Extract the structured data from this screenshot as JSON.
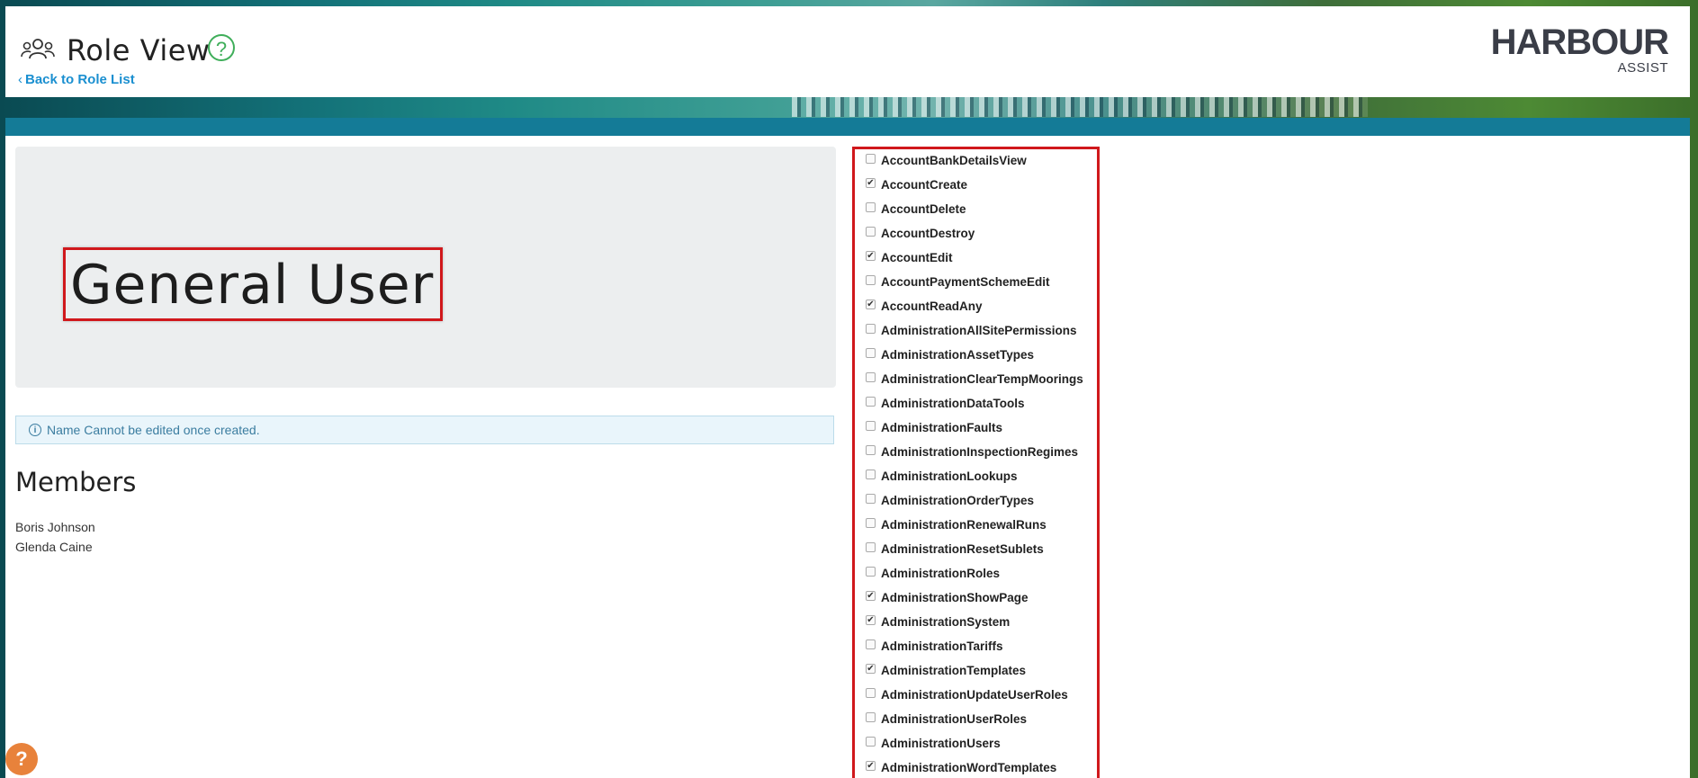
{
  "header": {
    "title": "Role View",
    "back_link": "Back to Role List",
    "logo_main": "HARBOUR",
    "logo_sub": "ASSIST"
  },
  "role": {
    "name": "General User",
    "info_note": "Name Cannot be edited once created."
  },
  "members": {
    "title": "Members",
    "list": [
      "Boris Johnson",
      "Glenda Caine"
    ]
  },
  "permissions": [
    {
      "label": "AccountBankDetailsView",
      "checked": false
    },
    {
      "label": "AccountCreate",
      "checked": true
    },
    {
      "label": "AccountDelete",
      "checked": false
    },
    {
      "label": "AccountDestroy",
      "checked": false
    },
    {
      "label": "AccountEdit",
      "checked": true
    },
    {
      "label": "AccountPaymentSchemeEdit",
      "checked": false
    },
    {
      "label": "AccountReadAny",
      "checked": true
    },
    {
      "label": "AdministrationAllSitePermissions",
      "checked": false
    },
    {
      "label": "AdministrationAssetTypes",
      "checked": false
    },
    {
      "label": "AdministrationClearTempMoorings",
      "checked": false
    },
    {
      "label": "AdministrationDataTools",
      "checked": false
    },
    {
      "label": "AdministrationFaults",
      "checked": false
    },
    {
      "label": "AdministrationInspectionRegimes",
      "checked": false
    },
    {
      "label": "AdministrationLookups",
      "checked": false
    },
    {
      "label": "AdministrationOrderTypes",
      "checked": false
    },
    {
      "label": "AdministrationRenewalRuns",
      "checked": false
    },
    {
      "label": "AdministrationResetSublets",
      "checked": false
    },
    {
      "label": "AdministrationRoles",
      "checked": false
    },
    {
      "label": "AdministrationShowPage",
      "checked": true
    },
    {
      "label": "AdministrationSystem",
      "checked": true
    },
    {
      "label": "AdministrationTariffs",
      "checked": false
    },
    {
      "label": "AdministrationTemplates",
      "checked": true
    },
    {
      "label": "AdministrationUpdateUserRoles",
      "checked": false
    },
    {
      "label": "AdministrationUserRoles",
      "checked": false
    },
    {
      "label": "AdministrationUsers",
      "checked": false
    },
    {
      "label": "AdministrationWordTemplates",
      "checked": true
    }
  ],
  "colors": {
    "accent_bar": "#147b97",
    "highlight_border": "#d0181c",
    "link": "#1a8fd0",
    "help_green": "#3fae5a",
    "help_bubble": "#e8823b"
  }
}
